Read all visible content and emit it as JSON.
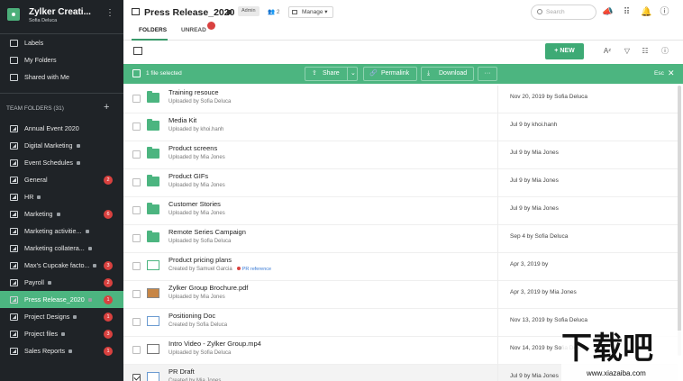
{
  "sidebar": {
    "org_name": "Zylker Creati...",
    "org_user": "Sofia Deluca",
    "nav": [
      {
        "label": "Labels",
        "icon": "label-icon"
      },
      {
        "label": "My Folders",
        "icon": "folder-icon"
      },
      {
        "label": "Shared with Me",
        "icon": "share-icon"
      }
    ],
    "team_header": "TEAM FOLDERS",
    "team_count": "(31)",
    "team_folders": [
      {
        "label": "Annual Event 2020",
        "lock": false,
        "badge": ""
      },
      {
        "label": "Digital Marketing",
        "lock": true,
        "badge": ""
      },
      {
        "label": "Event Schedules",
        "lock": true,
        "badge": ""
      },
      {
        "label": "General",
        "lock": false,
        "badge": "2"
      },
      {
        "label": "HR",
        "lock": true,
        "badge": ""
      },
      {
        "label": "Marketing",
        "lock": true,
        "badge": "6"
      },
      {
        "label": "Marketing activitie...",
        "lock": true,
        "badge": ""
      },
      {
        "label": "Marketing collatera...",
        "lock": true,
        "badge": ""
      },
      {
        "label": "Max's Cupcake facto...",
        "lock": true,
        "badge": "3"
      },
      {
        "label": "Payroll",
        "lock": true,
        "badge": "2"
      },
      {
        "label": "Press Release_2020",
        "lock": true,
        "badge": "1",
        "active": true
      },
      {
        "label": "Project Designs",
        "lock": true,
        "badge": "1"
      },
      {
        "label": "Project files",
        "lock": true,
        "badge": "3"
      },
      {
        "label": "Sales Reports",
        "lock": true,
        "badge": "1"
      }
    ]
  },
  "header": {
    "title": "Press Release_2020",
    "role": "Admin",
    "members": "2",
    "manage_label": "Manage",
    "search_placeholder": "Search"
  },
  "tabs": [
    {
      "label": "FOLDERS",
      "active": true
    },
    {
      "label": "UNREAD",
      "active": false,
      "badge": ""
    }
  ],
  "toolbar": {
    "new_label": "NEW"
  },
  "action_bar": {
    "selected_text": "1 file selected",
    "share": "Share",
    "permalink": "Permalink",
    "download": "Download",
    "more": "···",
    "esc": "Esc"
  },
  "files": [
    {
      "name": "Training resouce",
      "sub": "Uploaded by Sofia Deluca",
      "date": "Nov 20, 2019 by Sofia Deluca",
      "type": "folder"
    },
    {
      "name": "Media Kit",
      "sub": "Uploaded by khoi.hanh",
      "date": "Jul 9 by khoi.hanh",
      "type": "folder"
    },
    {
      "name": "Product screens",
      "sub": "Uploaded by Mia Jones",
      "date": "Jul 9 by Mia Jones",
      "type": "folder"
    },
    {
      "name": "Product GIFs",
      "sub": "Uploaded by Mia Jones",
      "date": "Jul 9 by Mia Jones",
      "type": "folder"
    },
    {
      "name": "Customer Stories",
      "sub": "Uploaded by Mia Jones",
      "date": "Jul 9 by Mia Jones",
      "type": "folder"
    },
    {
      "name": "Remote Series Campaign",
      "sub": "Uploaded by Sofia Deluca",
      "date": "Sep 4 by Sofia Deluca",
      "type": "folder"
    },
    {
      "name": "Product pricing plans",
      "sub": "Created by Samuel Garcia",
      "tag": "PR reference",
      "date": "Apr 3, 2019 by",
      "type": "sheet"
    },
    {
      "name": "Zylker Group Brochure.pdf",
      "sub": "Uploaded by Mia Jones",
      "date": "Apr 3, 2019 by Mia Jones",
      "type": "thumb"
    },
    {
      "name": "Positioning Doc",
      "sub": "Created by Sofia Deluca",
      "date": "Nov 13, 2019 by Sofia Deluca",
      "type": "doc"
    },
    {
      "name": "Intro Video - Zylker Group.mp4",
      "sub": "Uploaded by Sofia Deluca",
      "date": "Nov 14, 2019 by Sofia Deluca",
      "type": "video"
    },
    {
      "name": "PR Draft",
      "sub": "Created by Mia Jones",
      "date": "Jul 9 by Mia Jones",
      "type": "doc",
      "selected": true
    }
  ],
  "watermark": {
    "big": "下载吧",
    "small": "www.xiazaiba.com"
  }
}
